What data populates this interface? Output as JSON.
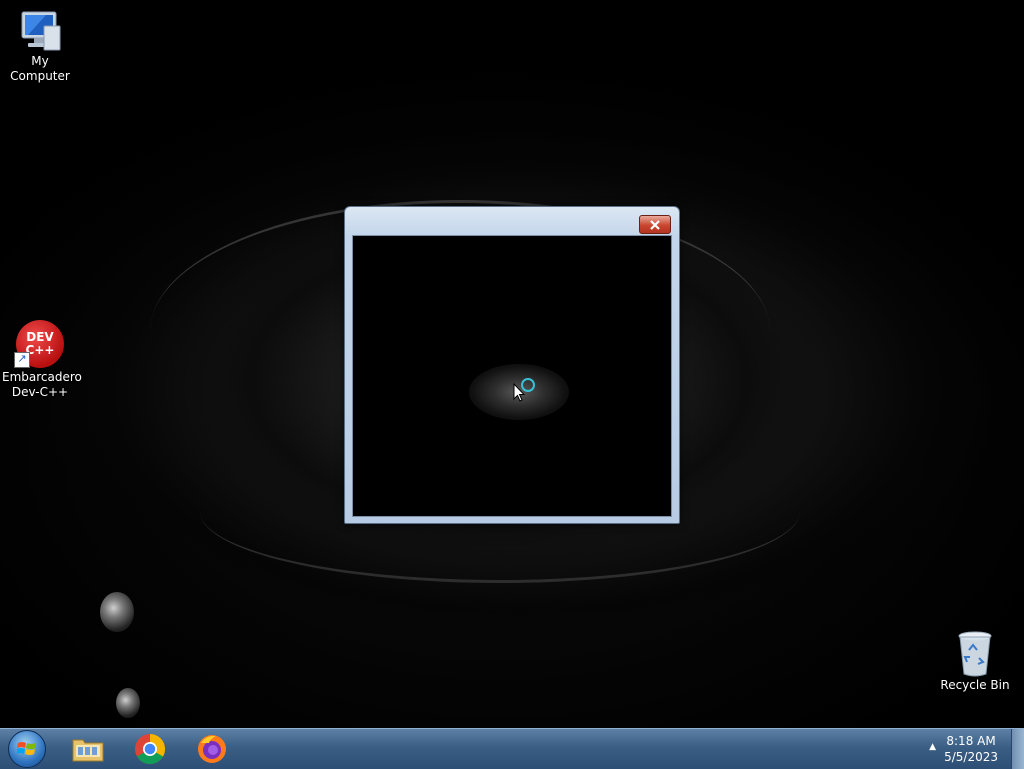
{
  "desktop": {
    "icons": [
      {
        "label": "My Computer",
        "icon": "computer-icon"
      },
      {
        "label": "Embarcadero Dev-C++",
        "icon_text": "DEV C++",
        "icon": "devcpp-icon"
      },
      {
        "label": "Recycle Bin",
        "icon": "recycle-bin-icon"
      }
    ]
  },
  "window": {
    "close_icon": "close-icon",
    "content": "dark-eye-image"
  },
  "taskbar": {
    "start_icon": "windows-start-icon",
    "pinned": [
      {
        "name": "File Explorer",
        "icon": "folder-icon"
      },
      {
        "name": "Google Chrome",
        "icon": "chrome-icon"
      },
      {
        "name": "Firefox",
        "icon": "firefox-icon"
      }
    ],
    "clock_time": "8:18 AM",
    "clock_date": "5/5/2023"
  },
  "colors": {
    "taskbar": "#3b5e85",
    "window_frame": "#c3d5ea",
    "close_button": "#c9462f"
  }
}
